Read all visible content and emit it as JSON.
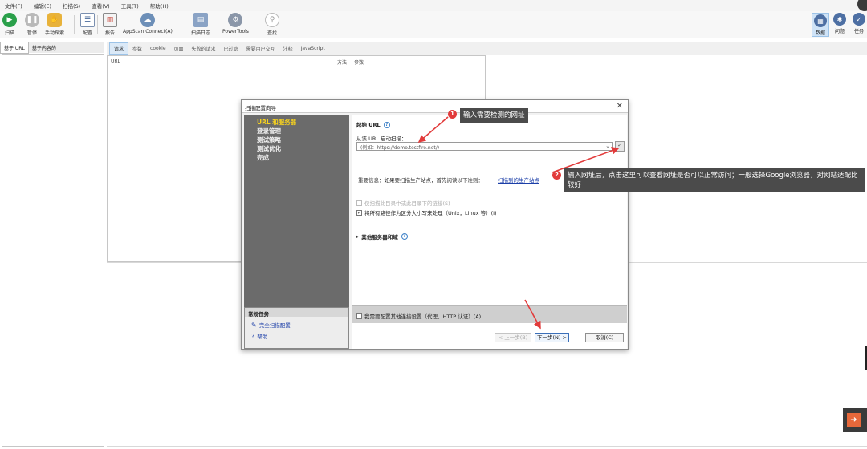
{
  "menu": [
    "文件(F)",
    "编辑(E)",
    "扫描(S)",
    "查看(V)",
    "工具(T)",
    "帮助(H)"
  ],
  "toolbar": {
    "scan": "扫描",
    "pause": "暂停",
    "manual_explore": "手动探索",
    "config": "配置",
    "report": "报告",
    "appscan_connect": "AppScan Connect(A)",
    "scan_log": "扫描日志",
    "powertools": "PowerTools",
    "find": "查找",
    "data": "数据",
    "issues": "问题",
    "tasks": "任务"
  },
  "left_tabs": [
    "基于 URL",
    "基于内容的"
  ],
  "right_tabs": [
    "请求",
    "参数",
    "cookie",
    "页面",
    "失败的请求",
    "已过滤",
    "需要用户交互",
    "注释",
    "JavaScript"
  ],
  "request_table": {
    "col_url": "URL",
    "col_method": "方法",
    "col_params": "参数"
  },
  "dialog": {
    "title": "扫描配置向导",
    "nav": [
      "URL 和服务器",
      "登录管理",
      "测试策略",
      "测试优化",
      "完成"
    ],
    "tasks_header": "常规任务",
    "task_full_config": "完全扫描配置",
    "task_help": "帮助",
    "start_url_label": "起始 URL",
    "url_field_label": "从该 URL 启动扫描：",
    "url_value": "(例如：https://demo.testfire.net/)",
    "note": "重要信息：如果要扫描生产站点，首先阅读以下准则：",
    "note_link": "扫描到的生产站点",
    "opt_only_scan": "仅扫描此目录中或此目录下的链接(S)",
    "opt_case": "将所有路径作为区分大小写来处理（Unix，Linux 等）(I)",
    "other_servers": "其他服务器和域",
    "footer_check": "我需要配置其他连接设置（代理、HTTP 认证）(A)",
    "back": "< 上一步(B)",
    "next": "下一步(N) >",
    "cancel": "取消(C)"
  },
  "annotations": {
    "badge1": "1",
    "callout1": "输入需要检测的网址",
    "badge2": "2",
    "callout2": "输入网址后，点击这里可以查看网址是否可以正常访问；一般选择Google浏览器，对网站适配比较好"
  },
  "colors": {
    "annotation_red": "#e23b3b",
    "nav_gray": "#6b6b6b",
    "nav_current": "#f7d21e",
    "link_blue": "#1c3fa8"
  }
}
